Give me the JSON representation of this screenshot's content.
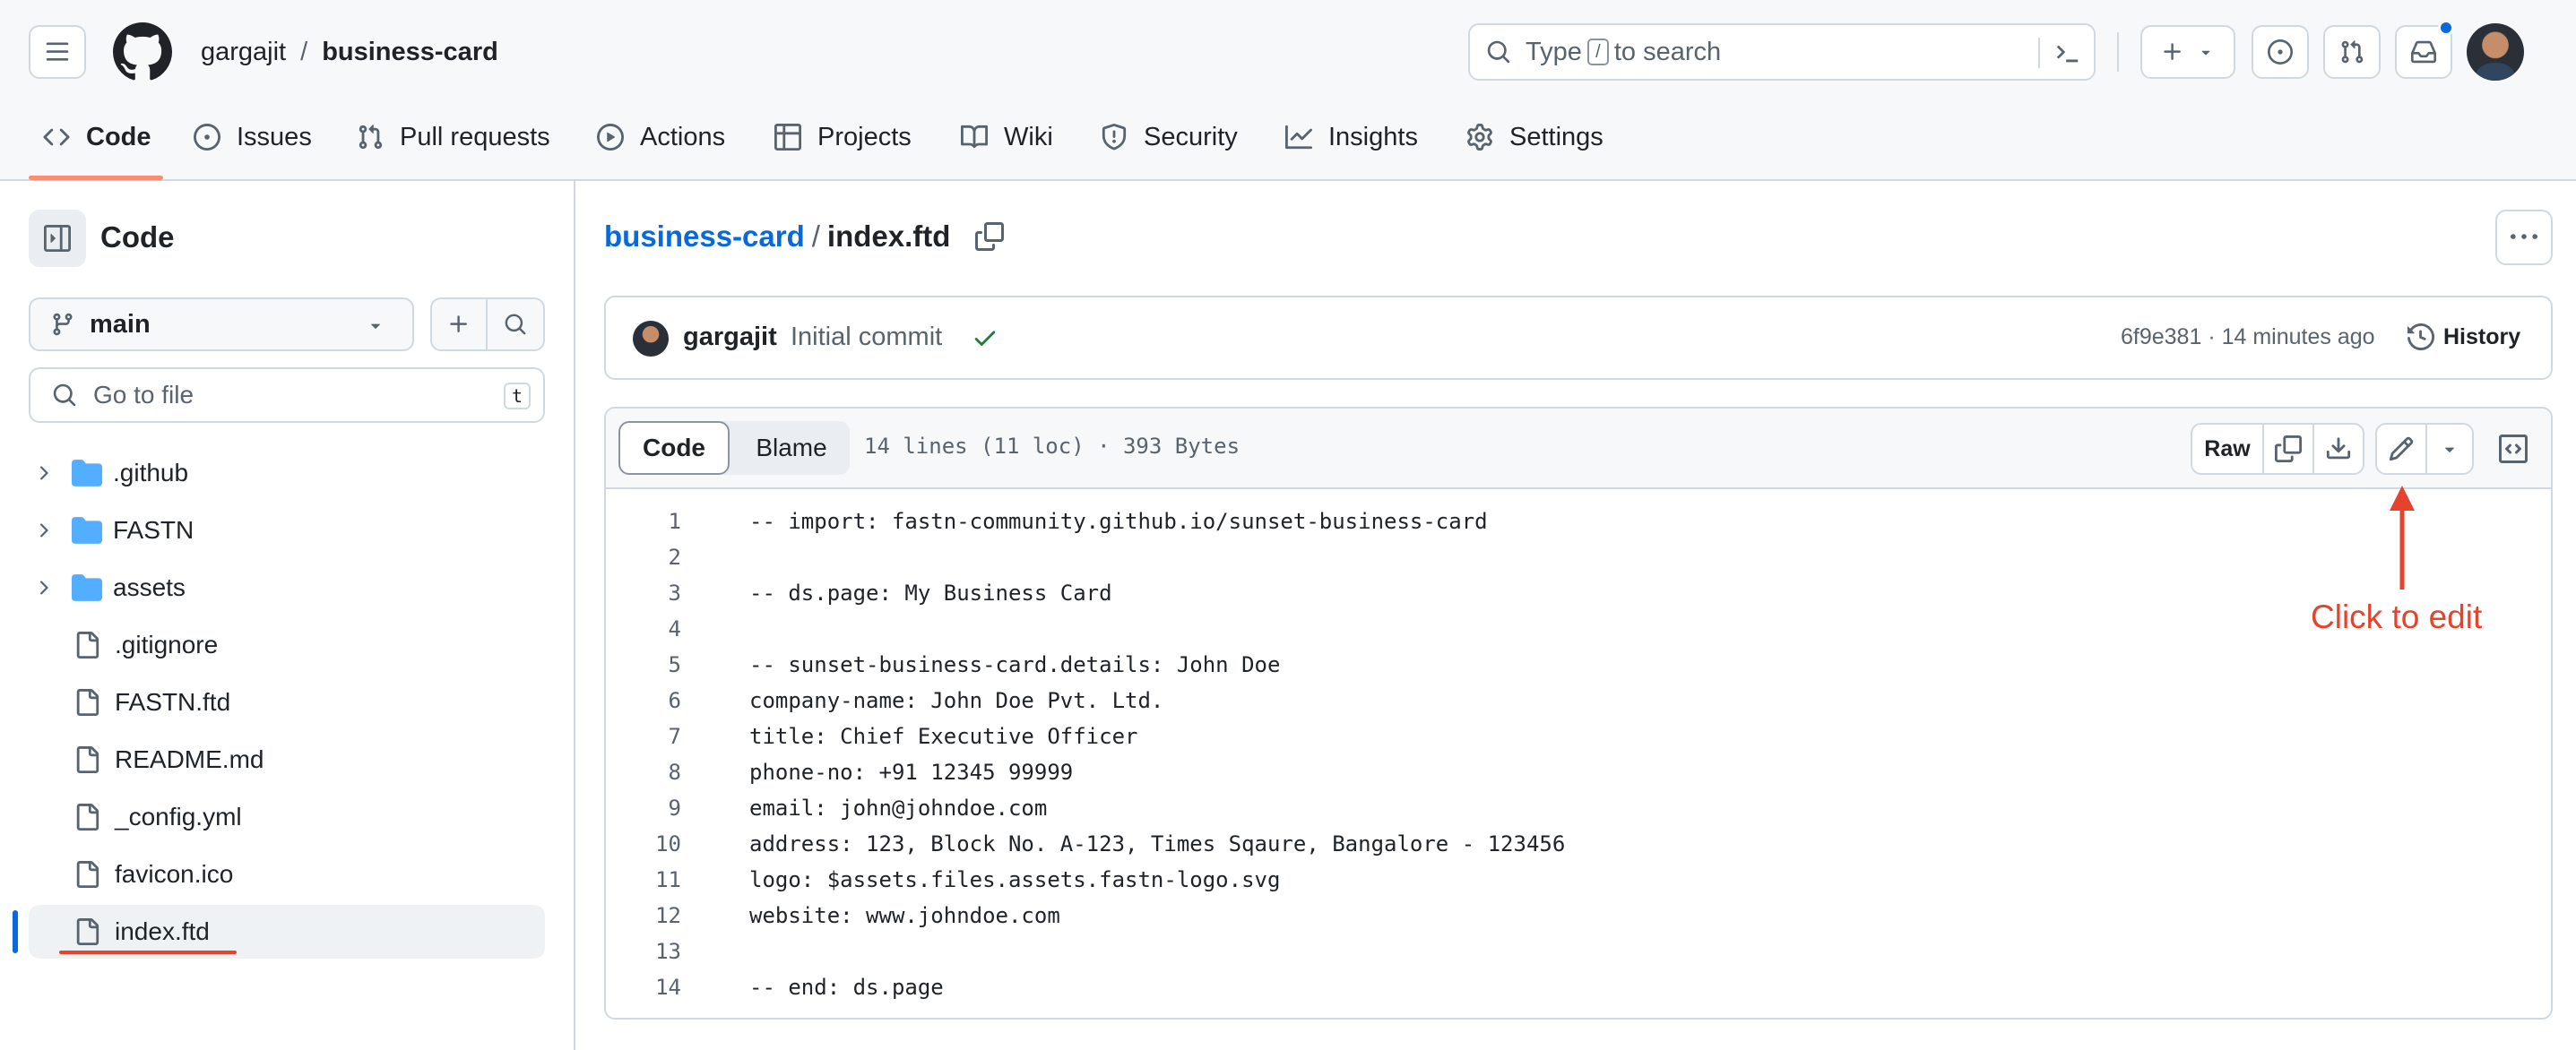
{
  "header": {
    "owner": "gargajit",
    "separator": "/",
    "repo": "business-card",
    "search_placeholder_pre": "Type",
    "search_key": "/",
    "search_placeholder_post": "to search"
  },
  "repo_tabs": [
    {
      "label": "Code",
      "icon": "code-icon"
    },
    {
      "label": "Issues",
      "icon": "issue-opened-icon"
    },
    {
      "label": "Pull requests",
      "icon": "git-pull-request-icon"
    },
    {
      "label": "Actions",
      "icon": "play-icon"
    },
    {
      "label": "Projects",
      "icon": "table-icon"
    },
    {
      "label": "Wiki",
      "icon": "book-icon"
    },
    {
      "label": "Security",
      "icon": "shield-icon"
    },
    {
      "label": "Insights",
      "icon": "graph-icon"
    },
    {
      "label": "Settings",
      "icon": "gear-icon"
    }
  ],
  "sidebar": {
    "title": "Code",
    "branch": "main",
    "goto_placeholder": "Go to file",
    "goto_key": "t",
    "items": [
      {
        "name": ".github",
        "type": "folder"
      },
      {
        "name": "FASTN",
        "type": "folder"
      },
      {
        "name": "assets",
        "type": "folder"
      },
      {
        "name": ".gitignore",
        "type": "file"
      },
      {
        "name": "FASTN.ftd",
        "type": "file"
      },
      {
        "name": "README.md",
        "type": "file"
      },
      {
        "name": "_config.yml",
        "type": "file"
      },
      {
        "name": "favicon.ico",
        "type": "file"
      },
      {
        "name": "index.ftd",
        "type": "file",
        "selected": true
      }
    ]
  },
  "file": {
    "breadcrumb_repo": "business-card",
    "breadcrumb_sep": "/",
    "filename": "index.ftd",
    "commit_author": "gargajit",
    "commit_message": "Initial commit",
    "commit_meta": "6f9e381 · 14 minutes ago",
    "history_label": "History",
    "view_code_label": "Code",
    "view_blame_label": "Blame",
    "stats": "14 lines (11 loc) · 393 Bytes",
    "raw_label": "Raw",
    "annotation": "Click to edit",
    "lines": [
      "-- import: fastn-community.github.io/sunset-business-card",
      "",
      "-- ds.page: My Business Card",
      "",
      "-- sunset-business-card.details: John Doe",
      "company-name: John Doe Pvt. Ltd.",
      "title: Chief Executive Officer",
      "phone-no: +91 12345 99999",
      "email: john@johndoe.com",
      "address: 123, Block No. A-123, Times Sqaure, Bangalore - 123456",
      "logo: $assets.files.assets.fastn-logo.svg",
      "website: www.johndoe.com",
      "",
      "-- end: ds.page"
    ],
    "line_numbers": [
      "1",
      "2",
      "3",
      "4",
      "5",
      "6",
      "7",
      "8",
      "9",
      "10",
      "11",
      "12",
      "13",
      "14"
    ]
  },
  "colors": {
    "accent_link": "#0969da",
    "tab_underline": "#fd8c73",
    "success": "#1a7f37",
    "annotation_red": "#e5432d",
    "notification_blue": "#0969da"
  }
}
